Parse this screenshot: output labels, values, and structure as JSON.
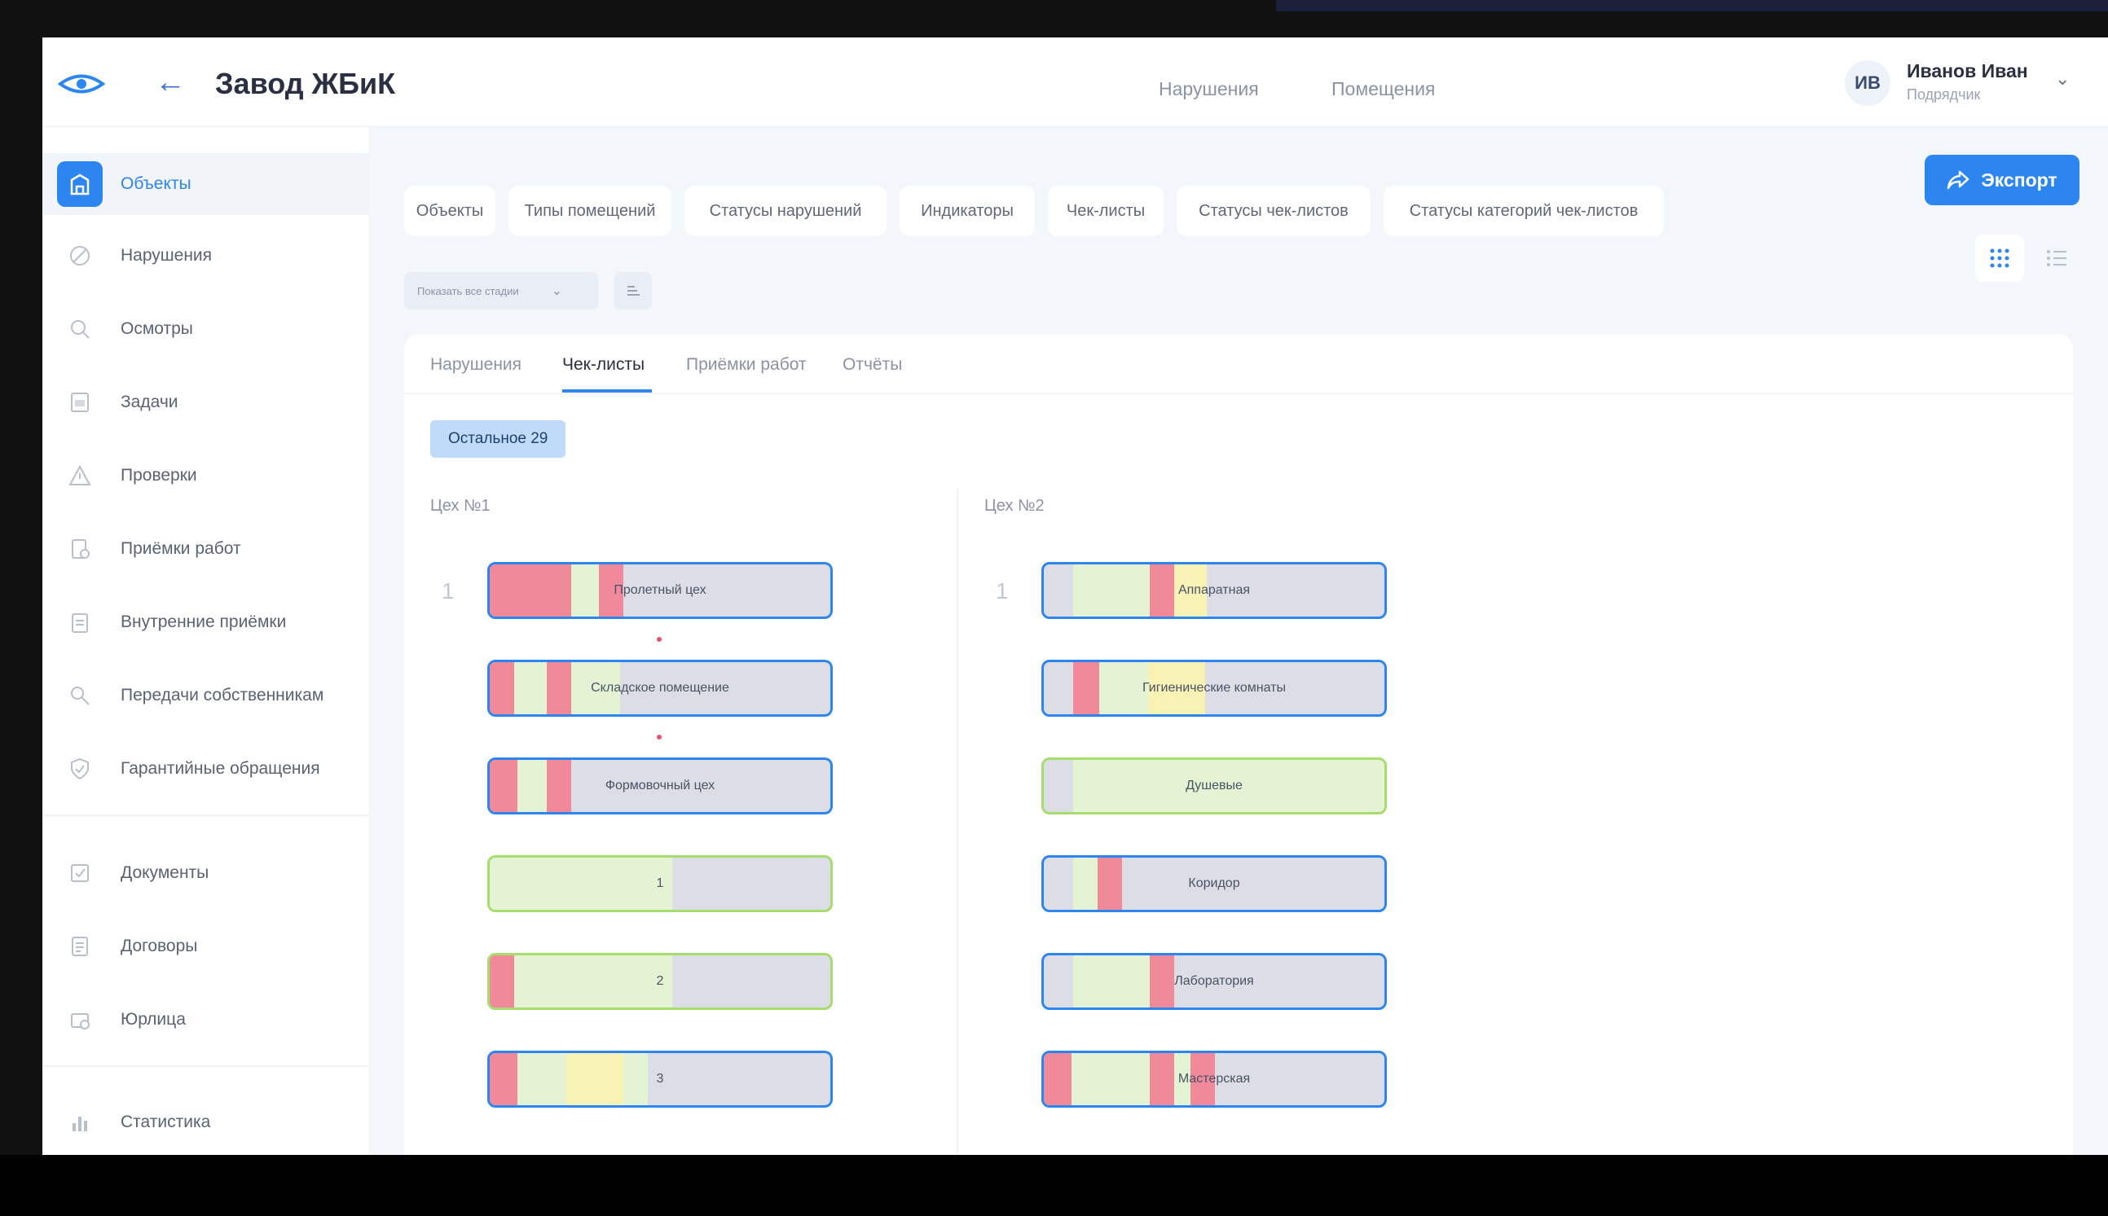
{
  "app": {
    "title": "Завод ЖБиК",
    "top_nav": [
      "Нарушения",
      "Помещения"
    ]
  },
  "user": {
    "initials": "ИВ",
    "name": "Иванов Иван",
    "role": "Подрядчик"
  },
  "sidebar": {
    "items": [
      {
        "label": "Объекты",
        "icon": "building-icon",
        "active": true
      },
      {
        "label": "Нарушения",
        "icon": "ban-icon"
      },
      {
        "label": "Осмотры",
        "icon": "search-icon"
      },
      {
        "label": "Задачи",
        "icon": "task-icon"
      },
      {
        "label": "Проверки",
        "icon": "warning-icon"
      },
      {
        "label": "Приёмки работ",
        "icon": "acceptance-icon"
      },
      {
        "label": "Внутренние приёмки",
        "icon": "clipboard-icon"
      },
      {
        "label": "Передачи собственникам",
        "icon": "handover-icon"
      },
      {
        "label": "Гарантийные обращения",
        "icon": "shield-icon"
      },
      {
        "label": "Документы",
        "icon": "document-check-icon"
      },
      {
        "label": "Договоры",
        "icon": "contract-icon"
      },
      {
        "label": "Юрлица",
        "icon": "legal-entity-icon"
      },
      {
        "label": "Статистика",
        "icon": "bar-chart-icon"
      }
    ]
  },
  "toolbar": {
    "filters": [
      "Объекты",
      "Типы помещений",
      "Статусы нарушений",
      "Индикаторы",
      "Чек-листы",
      "Статусы чек-листов",
      "Статусы категорий чек-листов"
    ],
    "export_label": "Экспорт",
    "stage_select": "Показать все стадии"
  },
  "tabs": [
    "Нарушения",
    "Чек-листы",
    "Приёмки работ",
    "Отчёты"
  ],
  "active_tab": "Чек-листы",
  "chip": "Остальное 29",
  "columns": [
    {
      "title": "Цех №1",
      "row_number": "1",
      "rooms": [
        {
          "label": "Пролетный цех",
          "border": "blue"
        },
        {
          "label": "Складское помещение",
          "border": "blue"
        },
        {
          "label": "Формовочный цех",
          "border": "blue"
        },
        {
          "label": "1",
          "border": "green"
        },
        {
          "label": "2",
          "border": "green"
        },
        {
          "label": "3",
          "border": "blue"
        }
      ]
    },
    {
      "title": "Цех №2",
      "row_number": "1",
      "rooms": [
        {
          "label": "Аппаратная",
          "border": "blue"
        },
        {
          "label": "Гигиенические комнаты",
          "border": "blue"
        },
        {
          "label": "Душевые",
          "border": "green"
        },
        {
          "label": "Коридор",
          "border": "blue"
        },
        {
          "label": "Лаборатория",
          "border": "blue"
        },
        {
          "label": "Мастерская",
          "border": "blue"
        }
      ]
    }
  ],
  "colors": {
    "accent": "#2d86f0",
    "status_red": "#f0899a",
    "status_green": "#e3f3d3",
    "status_yellow": "#f8f2b4",
    "status_grey": "#dcdde5"
  }
}
